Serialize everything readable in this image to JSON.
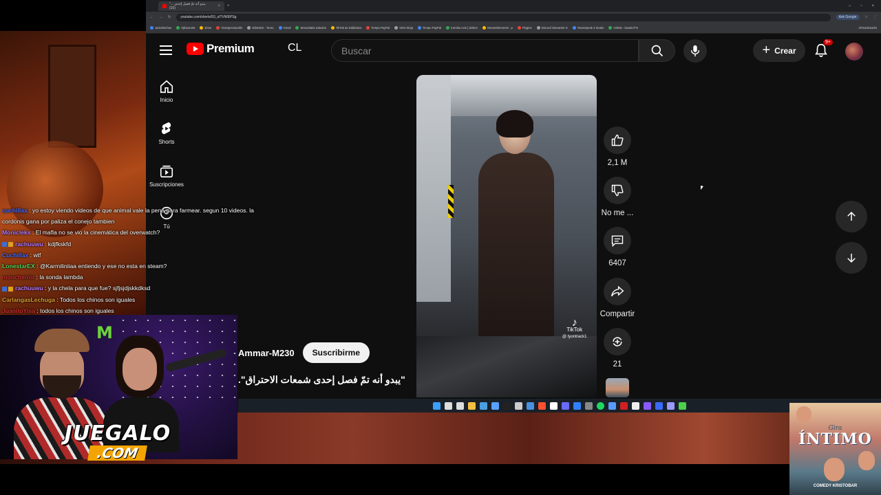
{
  "browser": {
    "tab_title": "\"يبدو أنه تمّ فصل إحدى ... (10)",
    "tab_close": "×",
    "new_tab": "+",
    "win_controls": [
      "–",
      "▫",
      "×"
    ],
    "url": "youtube.com/shorts/53_sITVWEPSg",
    "ask_google": "Ask Google",
    "bookmarks": [
      "Jackelinchan",
      "Ojiboom25",
      "Drive",
      "Victrapreviaonfin",
      "Editestck - Teoru",
      "Gmail",
      "Streamlabs Saludos",
      "TikTok de Eddiebow",
      "Tempo PayPal",
      "VDO.Ninja",
      "Tempo PayPal",
      "Komika Axis | deltom",
      "StreamElements - p",
      "Plugins",
      "Discord StreamKit O",
      "TeamSpeak 3 Studio",
      "Github - braden/TS"
    ],
    "all_bookmarks": "All Bookmarks"
  },
  "youtube": {
    "logo_text": "Premium",
    "country_code": "CL",
    "search_placeholder": "Buscar",
    "create_label": "Crear",
    "notification_count": "9+",
    "nav": [
      {
        "label": "Inicio",
        "icon": "home-icon"
      },
      {
        "label": "Shorts",
        "icon": "shorts-icon"
      },
      {
        "label": "Suscripciones",
        "icon": "subscriptions-icon"
      },
      {
        "label": "Tú",
        "icon": "you-icon"
      }
    ],
    "short": {
      "likes": "2,1 M",
      "dislike_label": "No me ...",
      "comments": "6407",
      "share_label": "Compartir",
      "remix_count": "21",
      "channel": "Ammar-M230",
      "subscribe_label": "Suscribirme",
      "caption": "\"يبدو أنه تمّ فصل إحدى شمعات الاحتراق\".",
      "watermark_brand": "TikTok",
      "watermark_handle": "@ tyontrack1"
    }
  },
  "chat": [
    {
      "user": "cuchillax",
      "user_color": "#4a6cff",
      "badges": false,
      "msg": "yo estoy viendo videos de que animal vale la pena para farmear. segun 10 videos. la"
    },
    {
      "user": "",
      "user_color": "#ffffff",
      "badges": false,
      "msg": "cordonis gana por paliza el conejo tambien"
    },
    {
      "user": "Monicleks",
      "user_color": "#b97cff",
      "badges": false,
      "msg": "El mafla no se vio la cinemática del overwatch?"
    },
    {
      "user": "rachuuwu",
      "user_color": "#b97cff",
      "badges": true,
      "msg": "kdjfkskfd"
    },
    {
      "user": "Cuchillax",
      "user_color": "#4a6cff",
      "badges": false,
      "msg": "wtf"
    },
    {
      "user": "LonestarEX",
      "user_color": "#5ad25a",
      "badges": false,
      "msg": "@Karmiliniiaa entiendo y ese no esta en steam?"
    },
    {
      "user": "moncherior",
      "user_color": "#d03030",
      "badges": false,
      "msg": "la sonda lambda"
    },
    {
      "user": "rachuuwu",
      "user_color": "#b97cff",
      "badges": true,
      "msg": "y la chela para que fue? sjfjsjdjskkdksd"
    },
    {
      "user": "CarlangasLechuga",
      "user_color": "#e0a030",
      "badges": false,
      "msg": "Todos los chinos son iguales"
    },
    {
      "user": "JuanitoYisa",
      "user_color": "#d03030",
      "badges": false,
      "msg": "todos los chinos son iguales"
    }
  ],
  "overlay": {
    "juegalo_main": "JUEGALO",
    "juegalo_com": ".COM"
  },
  "poster": {
    "title_small": "Gira",
    "title_big": "ÍNTIMO",
    "footer": "COMEDY KRISTOBAR"
  },
  "taskbar_colors": [
    "#3aa0ff",
    "#ddd",
    "#ddd",
    "#f4c040",
    "#4aa0e0",
    "#5aa0ff",
    "#222",
    "#ccc",
    "#4a90e0",
    "#ff5030",
    "#fff",
    "#6a6aff",
    "#3080ff",
    "#888",
    "#1ed760",
    "#5a9aff",
    "#d02020",
    "#eee",
    "#8a5aff",
    "#3a6aff",
    "#9a9aff",
    "#4ad04a"
  ]
}
